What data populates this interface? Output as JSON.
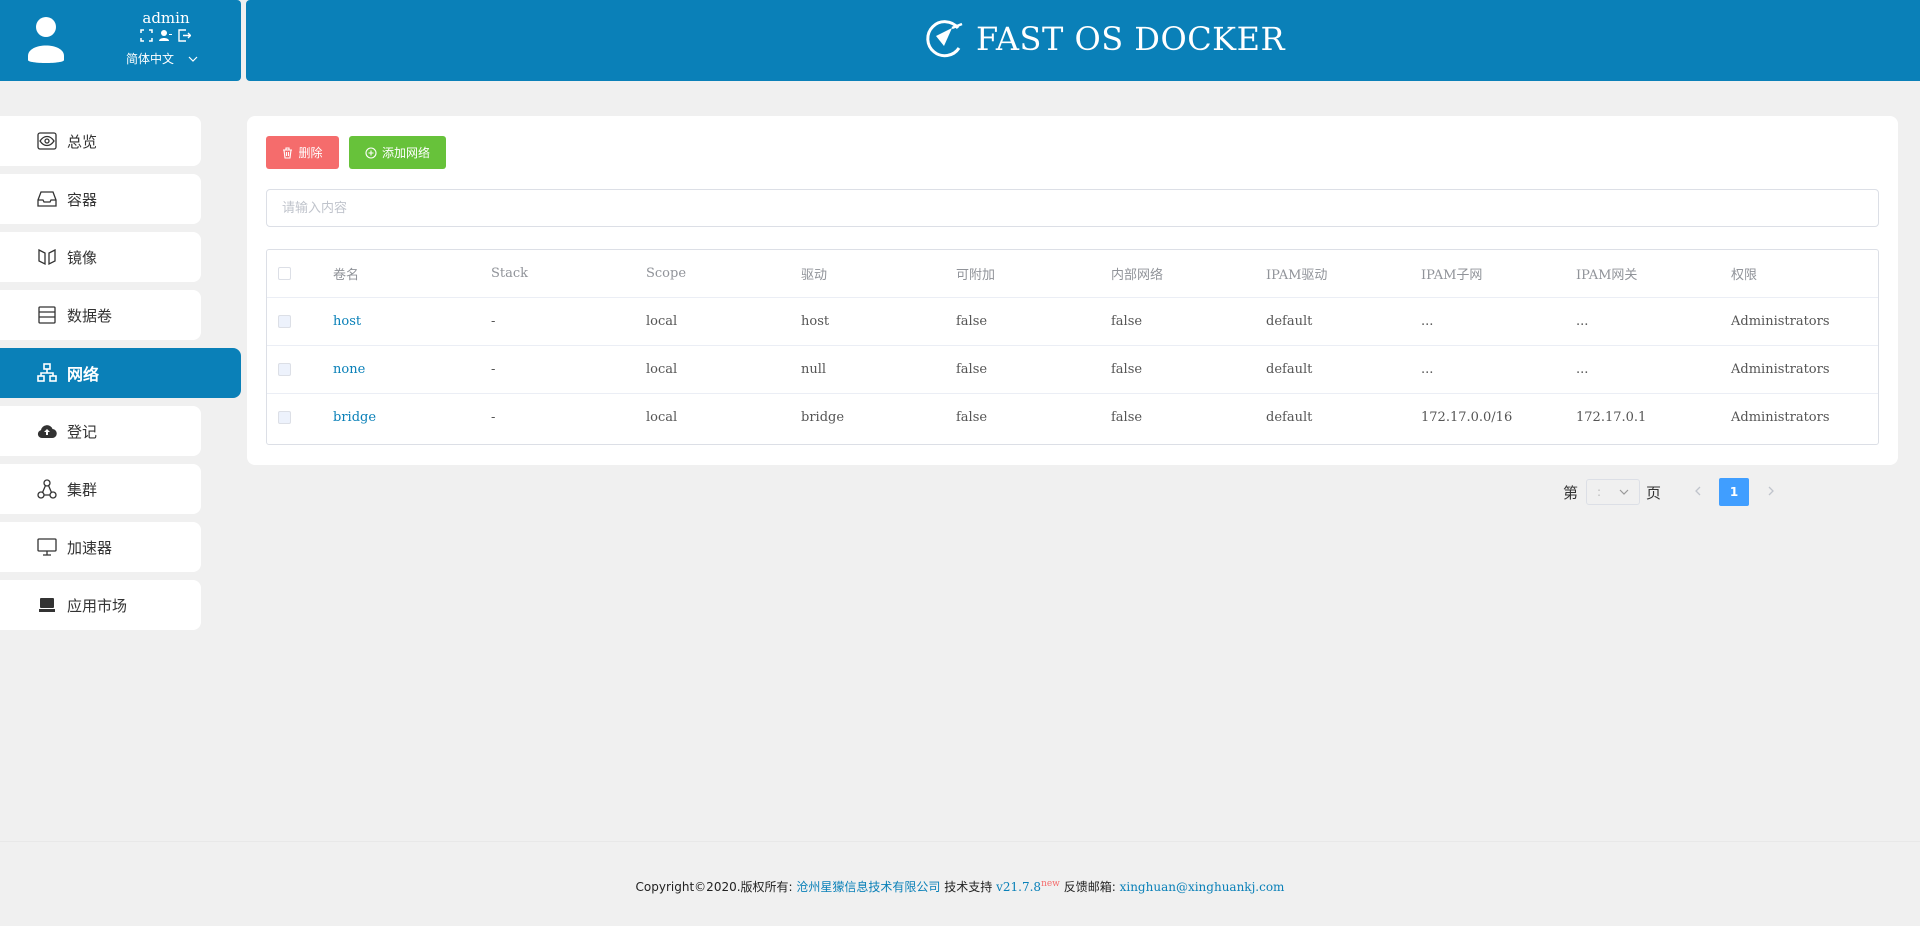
{
  "user": {
    "name": "admin",
    "language": "简体中文"
  },
  "header": {
    "title": "FAST OS DOCKER"
  },
  "sidebar": {
    "items": [
      {
        "label": "总览",
        "icon": "eye-icon"
      },
      {
        "label": "容器",
        "icon": "inbox-icon"
      },
      {
        "label": "镜像",
        "icon": "image-icon"
      },
      {
        "label": "数据卷",
        "icon": "list-icon"
      },
      {
        "label": "网络",
        "icon": "network-icon",
        "active": true
      },
      {
        "label": "登记",
        "icon": "cloud-upload-icon"
      },
      {
        "label": "集群",
        "icon": "cluster-icon"
      },
      {
        "label": "加速器",
        "icon": "monitor-icon"
      },
      {
        "label": "应用市场",
        "icon": "store-icon"
      }
    ]
  },
  "toolbar": {
    "delete_label": "删除",
    "add_label": "添加网络"
  },
  "search": {
    "placeholder": "请输入内容"
  },
  "table": {
    "headers": [
      "卷名",
      "Stack",
      "Scope",
      "驱动",
      "可附加",
      "内部网络",
      "IPAM驱动",
      "IPAM子网",
      "IPAM网关",
      "权限"
    ],
    "rows": [
      [
        "host",
        "-",
        "local",
        "host",
        "false",
        "false",
        "default",
        "...",
        "...",
        "Administrators"
      ],
      [
        "none",
        "-",
        "local",
        "null",
        "false",
        "false",
        "default",
        "...",
        "...",
        "Administrators"
      ],
      [
        "bridge",
        "-",
        "local",
        "bridge",
        "false",
        "false",
        "default",
        "172.17.0.0/16",
        "172.17.0.1",
        "Administrators"
      ]
    ]
  },
  "pagination": {
    "prefix": "第",
    "select_value": ":",
    "suffix": "页",
    "current": "1"
  },
  "footer": {
    "copyright": "Copyright©2020.版权所有:",
    "company": "沧州星獴信息技术有限公司",
    "support_label": "技术支持",
    "version": "v21.7.8",
    "new_badge": "new",
    "feedback_label": "反馈邮箱:",
    "email": "xinghuan@xinghuankj.com"
  },
  "colors": {
    "primary": "#0a80b8",
    "danger": "#f56c6c",
    "success": "#67c23a",
    "page_active": "#409eff"
  }
}
